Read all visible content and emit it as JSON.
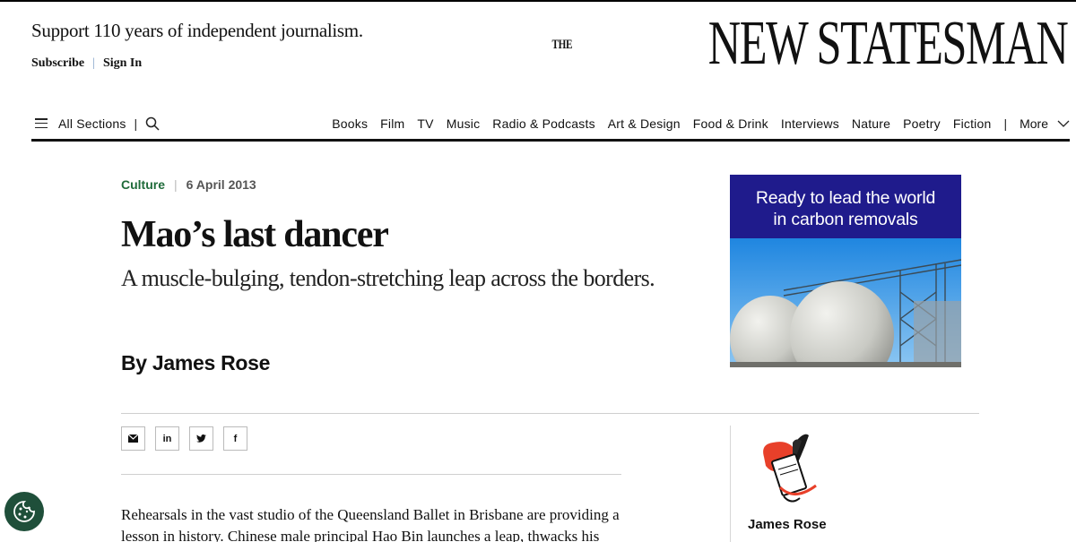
{
  "header": {
    "support_text": "Support 110 years of independent journalism.",
    "subscribe": "Subscribe",
    "separator": "|",
    "sign_in": "Sign In",
    "logo_the": "THE",
    "logo_name": "NEW STATESMAN"
  },
  "nav": {
    "all_sections": "All Sections",
    "pipe": "|",
    "items": [
      "Books",
      "Film",
      "TV",
      "Music",
      "Radio & Podcasts",
      "Art & Design",
      "Food & Drink",
      "Interviews",
      "Nature",
      "Poetry",
      "Fiction"
    ],
    "more": "More"
  },
  "article": {
    "section": "Culture",
    "meta_separator": "|",
    "date": "6 April 2013",
    "headline": "Mao’s last dancer",
    "standfirst": "A muscle-bulging, tendon-stretching leap across the borders.",
    "byline": "By James Rose",
    "body": "Rehearsals in the vast studio of the Queensland Ballet in Brisbane are providing a lesson in history. Chinese male principal Hao Bin launches a leap, thwacks his"
  },
  "share": [
    {
      "label": "✉",
      "icon": "email-icon"
    },
    {
      "label": "in",
      "icon": "linkedin-icon"
    },
    {
      "label": "🐦",
      "icon": "twitter-icon"
    },
    {
      "label": "f",
      "icon": "facebook-icon"
    }
  ],
  "ad": {
    "line1": "Ready to lead the world",
    "line2": "in carbon removals"
  },
  "author": {
    "name": "James Rose"
  },
  "colors": {
    "section_green": "#1f6b3a",
    "ad_band": "#1f1b8c",
    "cookie_button": "#1f4f3a"
  }
}
